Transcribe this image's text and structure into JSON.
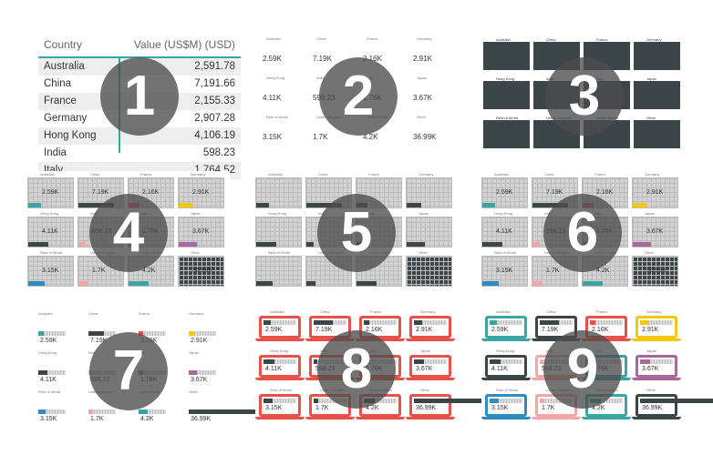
{
  "panel_numbers": [
    "1",
    "2",
    "3",
    "4",
    "5",
    "6",
    "7",
    "8",
    "9"
  ],
  "table": {
    "header_country": "Country",
    "header_value": "Value (US$M) (USD)",
    "rows": [
      {
        "country": "Australia",
        "value": "2,591.78"
      },
      {
        "country": "China",
        "value": "7,191.66"
      },
      {
        "country": "France",
        "value": "2,155.33"
      },
      {
        "country": "Germany",
        "value": "2,907.28"
      },
      {
        "country": "Hong Kong",
        "value": "4,106.19"
      },
      {
        "country": "India",
        "value": "598.23"
      },
      {
        "country": "Italy",
        "value": "1,764.52"
      }
    ]
  },
  "countries": [
    "Australia",
    "China",
    "France",
    "Germany",
    "Hong Kong",
    "India",
    "Italy",
    "Japan",
    "Rest of World",
    "United Kingdom",
    "United States",
    "Other"
  ],
  "short_values": [
    "2.59K",
    "7.19K",
    "2.16K",
    "2.91K",
    "4.11K",
    "598.23",
    "1.76K",
    "3.67K",
    "3.15K",
    "1.7K",
    "4.2K",
    "36.99K"
  ],
  "fill_fractions": [
    0.07,
    0.19,
    0.06,
    0.08,
    0.11,
    0.02,
    0.05,
    0.1,
    0.09,
    0.05,
    0.11,
    1.0
  ],
  "colors": {
    "teal": "#3aa6a3",
    "dark": "#3c4548",
    "red": "#e8514a",
    "yellow": "#f2c80f",
    "purple": "#a66999",
    "pink": "#f4a6a6",
    "grey_grid": "#d3d3d3",
    "blue": "#2e8bc0",
    "orange": "#f08a24"
  },
  "cell_colors": [
    "#3aa6a3",
    "#3c4548",
    "#e8514a",
    "#f2c80f",
    "#3c4548",
    "#f4a6a6",
    "#3aa6a3",
    "#a66999",
    "#2e8bc0",
    "#f4a6a6",
    "#3aa6a3",
    "#3c4548"
  ]
}
